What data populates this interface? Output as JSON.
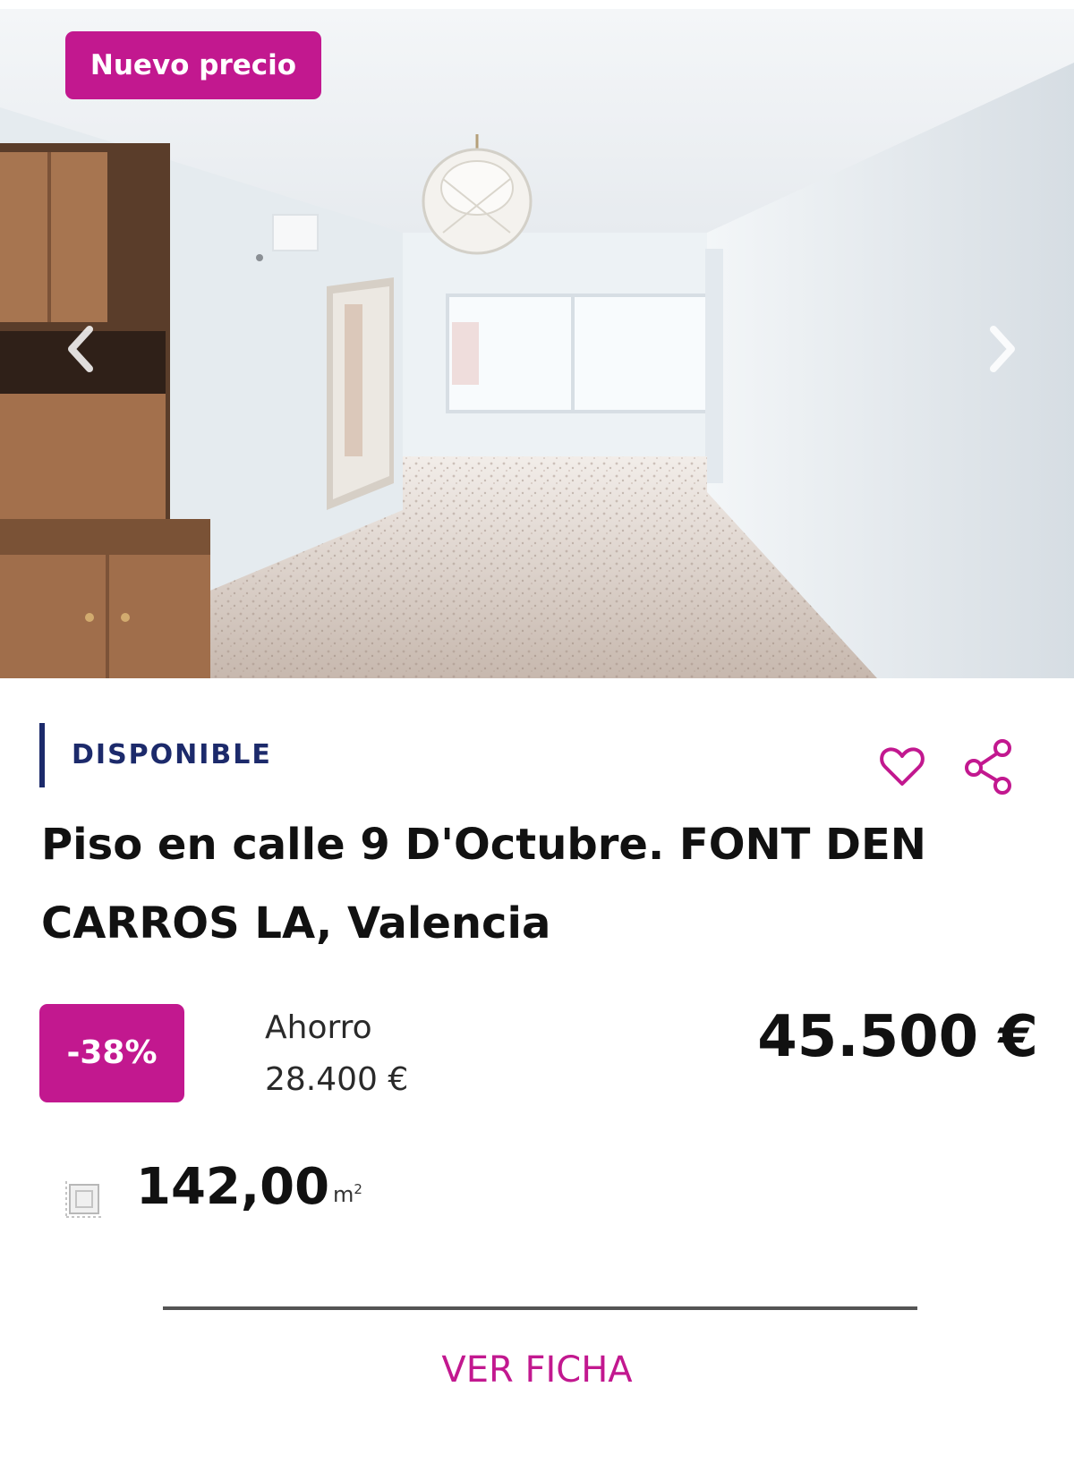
{
  "listing": {
    "badge_new": "Nuevo precio",
    "status": "DISPONIBLE",
    "title": "Piso en calle 9 D'Octubre. FONT DEN CARROS LA, Valencia",
    "discount": "-38%",
    "savings_label": "Ahorro",
    "savings_value": "28.400 €",
    "price": "45.500 €",
    "area_value": "142,00",
    "area_unit": "m",
    "area_unit_sup": "2",
    "cta_label": "VER FICHA"
  },
  "icons": {
    "prev": "chevron-left-icon",
    "next": "chevron-right-icon",
    "favorite": "heart-icon",
    "share": "share-icon",
    "area": "floor-area-icon"
  },
  "colors": {
    "accent": "#c2188f",
    "status": "#1c2a6b",
    "text": "#111111"
  }
}
